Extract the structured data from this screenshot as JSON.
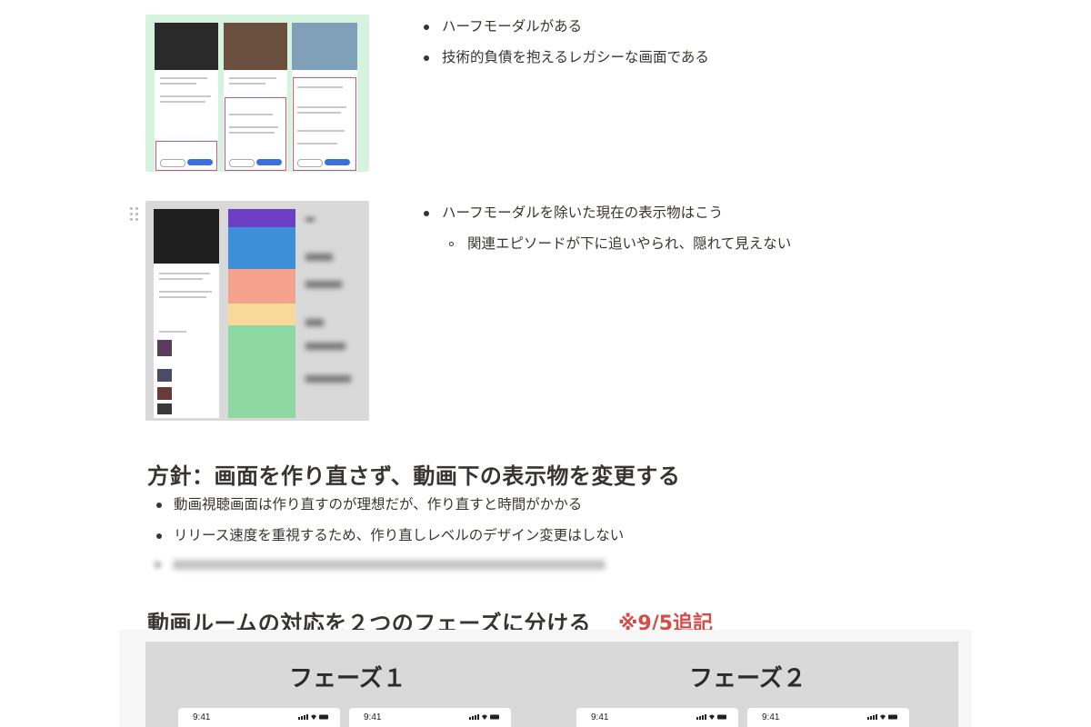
{
  "section1": {
    "bullets": [
      "ハーフモーダルがある",
      "技術的負債を抱えるレガシーな画面である"
    ]
  },
  "section2": {
    "bullet": "ハーフモーダルを除いた現在の表示物はこう",
    "sub_bullet": "関連エピソードが下に追いやられ、隠れて見えない"
  },
  "policy": {
    "heading": "方針：画面を作り直さず、動画下の表示物を変更する",
    "bullets": [
      "動画視聴画面は作り直すのが理想だが、作り直すと時間がかかる",
      "リリース速度を重視するため、作り直しレベルのデザイン変更はしない"
    ]
  },
  "phases": {
    "heading": "動画ルームの対応を２つのフェーズに分ける",
    "note": "※9/5追記",
    "phase1": "フェーズ１",
    "phase2": "フェーズ２",
    "time": "9:41"
  },
  "colors": {
    "note_red": "#d44c47",
    "pink_outline": "#e0507a",
    "mint_bg": "#d6f3e0"
  }
}
